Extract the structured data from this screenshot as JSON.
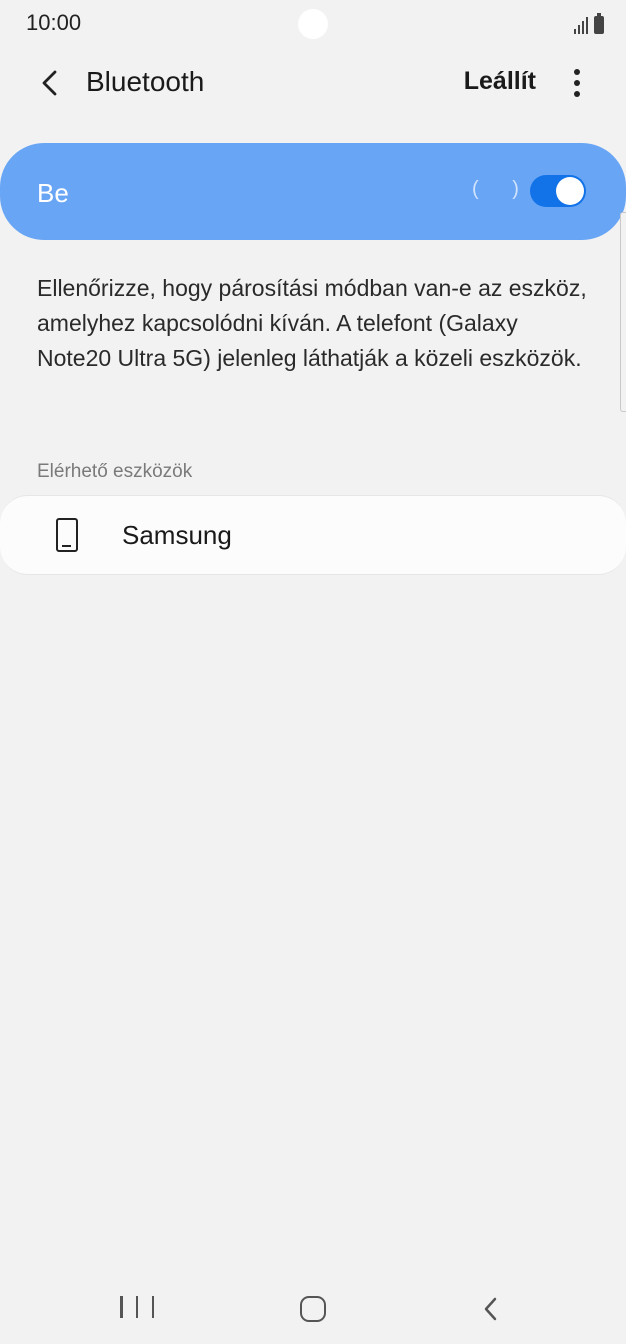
{
  "status_bar": {
    "time": "10:00",
    "icons": [
      "camera-cutout",
      "signal-icon",
      "battery-icon"
    ]
  },
  "app_bar": {
    "title": "Bluetooth",
    "back_icon": "chevron-left-icon",
    "stop_label": "Leállít",
    "more_icon": "more-vertical-icon"
  },
  "master_toggle": {
    "label": "Be",
    "scanning_indicator": "( )",
    "enabled": true,
    "color_row": "#68a5f5",
    "color_switch": "#1273e8"
  },
  "description": "Ellenőrizze, hogy párosítási módban van-e az eszköz, amelyhez kapcsolódni kíván. A telefont (Galaxy Note20 Ultra 5G) jelenleg láthatják a közeli eszközök.",
  "available_devices": {
    "header": "Elérhető eszközök",
    "items": [
      {
        "name": "Samsung",
        "icon": "phone-icon"
      }
    ]
  },
  "nav_bar": {
    "icons": [
      "recent-apps-icon",
      "home-icon",
      "back-icon"
    ]
  }
}
